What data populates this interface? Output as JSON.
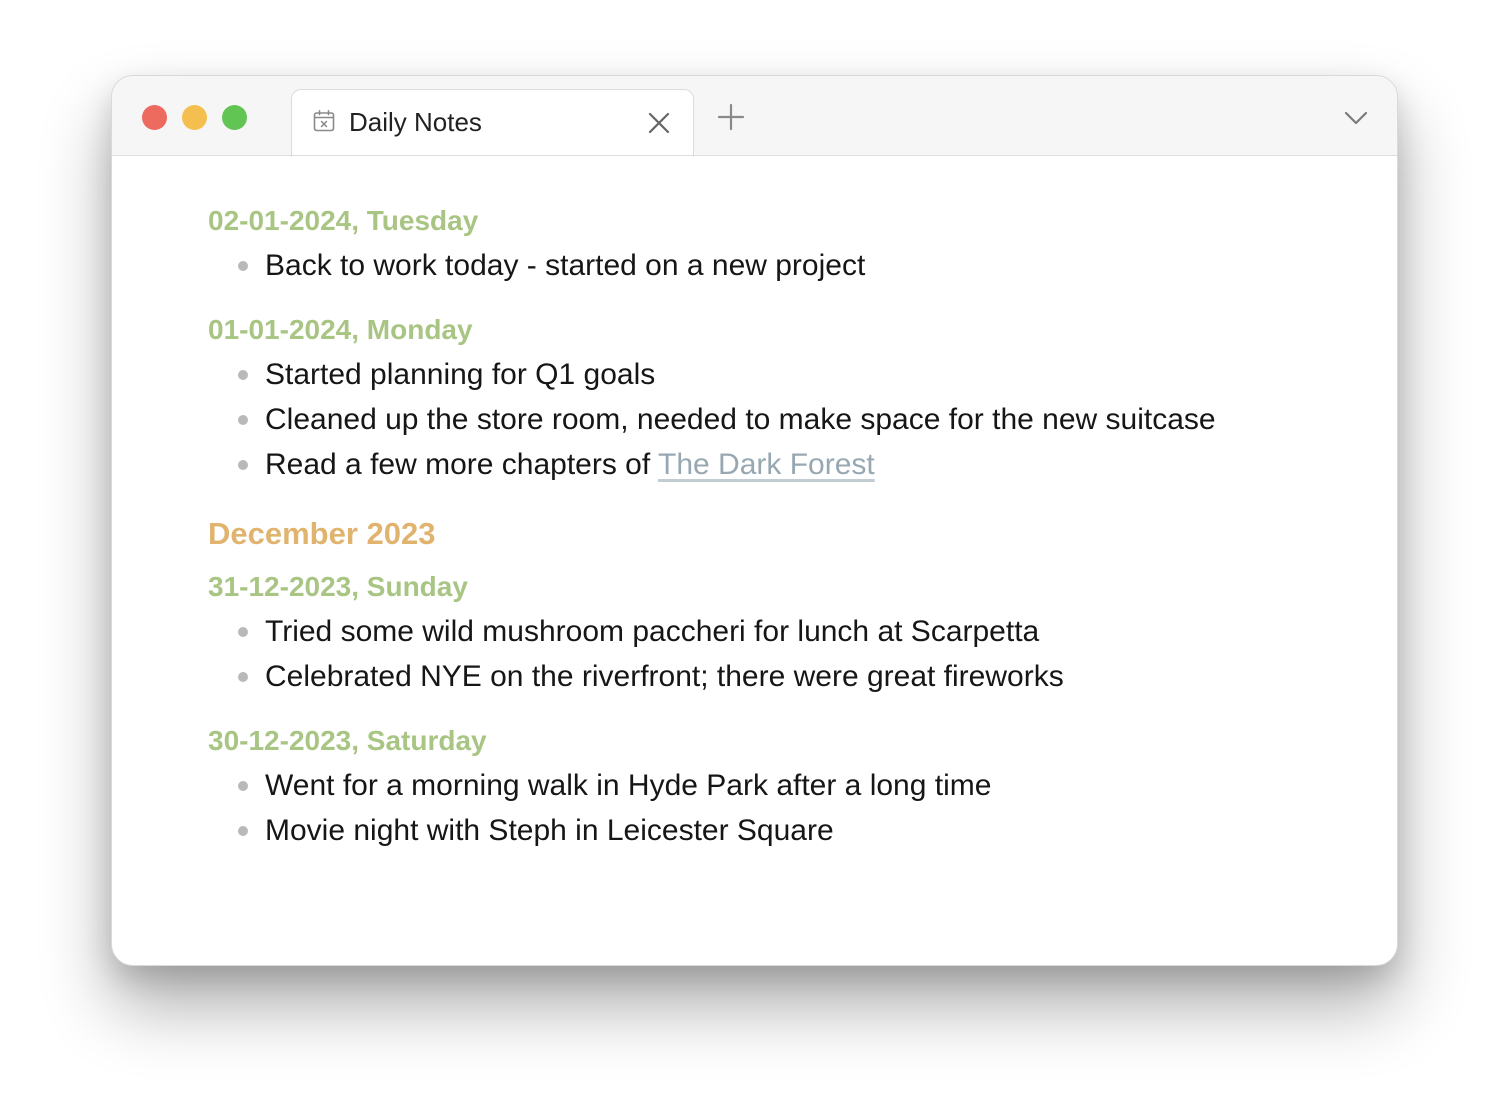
{
  "window": {
    "tab": {
      "label": "Daily Notes",
      "icon": "calendar-icon",
      "close_icon": "close-icon"
    },
    "new_tab_icon": "plus-icon",
    "dropdown_icon": "chevron-down-icon"
  },
  "notes": {
    "day1": {
      "heading": "02-01-2024, Tuesday",
      "items": [
        "Back to work today - started on a new project"
      ]
    },
    "day2": {
      "heading": "01-01-2024, Monday",
      "items": [
        "Started planning for Q1 goals",
        "Cleaned up the store room, needed to make space for the new suitcase"
      ],
      "link_item_prefix": "Read a few more chapters of ",
      "link_text": "The Dark Forest"
    },
    "month": "December 2023",
    "day3": {
      "heading": "31-12-2023, Sunday",
      "items": [
        "Tried some wild mushroom paccheri for lunch at Scarpetta",
        "Celebrated NYE on the riverfront; there were great fireworks"
      ]
    },
    "day4": {
      "heading": "30-12-2023, Saturday",
      "items": [
        "Went for a morning walk in Hyde Park after a long time",
        "Movie night with Steph in Leicester Square"
      ]
    }
  },
  "colors": {
    "day_heading": "#a9c584",
    "month_heading": "#e0b46e",
    "link": "#97a8b3",
    "traffic_close": "#ec6a5e",
    "traffic_minimize": "#f4bf4f",
    "traffic_maximize": "#61c554"
  }
}
